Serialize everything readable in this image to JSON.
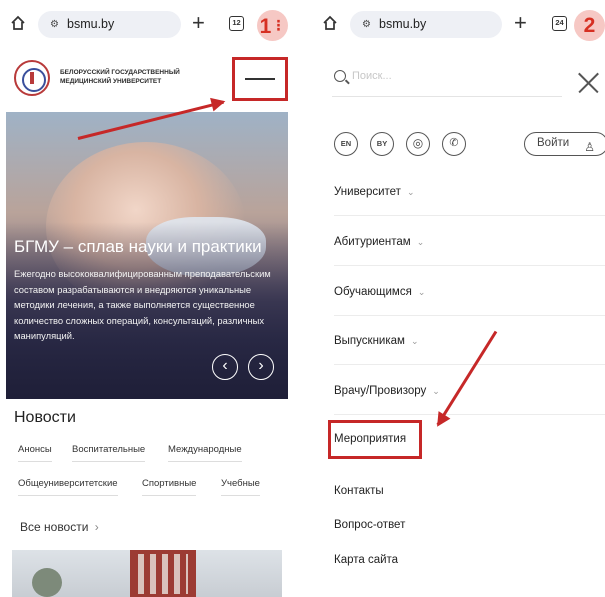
{
  "left": {
    "browser": {
      "url": "bsmu.by",
      "tab_count": "12",
      "step": "1"
    },
    "site_name_line1": "БЕЛОРУССКИЙ ГОСУДАРСТВЕННЫЙ",
    "site_name_line2": "МЕДИЦИНСКИЙ УНИВЕРСИТЕТ",
    "hero": {
      "title": "БГМУ – сплав науки и практики",
      "text": "Ежегодно высококвалифицированным преподавательским составом разрабатываются и внедряются уникальные методики лечения, а также выполняется существенное количество сложных операций, консультаций, различных манипуляций.",
      "prev_icon": "‹",
      "next_icon": "›"
    },
    "news": {
      "title": "Новости",
      "tags_row1": [
        "Анонсы",
        "Воспитательные",
        "Международные"
      ],
      "tags_row2": [
        "Общеуниверситетские",
        "Спортивные",
        "Учебные"
      ],
      "all_news": "Все новости",
      "all_news_chevron": "›"
    }
  },
  "right": {
    "browser": {
      "url": "bsmu.by",
      "tab_count": "24",
      "step": "2"
    },
    "search_placeholder": "Поиск...",
    "lang_buttons": [
      "EN",
      "BY"
    ],
    "login_label": "Войти",
    "menu_items": [
      {
        "label": "Университет",
        "chevron": "⌄"
      },
      {
        "label": "Абитуриентам",
        "chevron": "⌄"
      },
      {
        "label": "Обучающимся",
        "chevron": "⌄"
      },
      {
        "label": "Выпускникам",
        "chevron": "⌄"
      },
      {
        "label": "Врачу/Провизору",
        "chevron": "⌄"
      },
      {
        "label": "Мероприятия",
        "chevron": ""
      },
      {
        "label": "Контакты",
        "chevron": ""
      },
      {
        "label": "Вопрос-ответ",
        "chevron": ""
      },
      {
        "label": "Карта сайта",
        "chevron": ""
      }
    ]
  },
  "colors": {
    "annotation_red": "#c62828",
    "badge_bg": "#f6c8c4",
    "url_bar_bg": "#eef0f5"
  },
  "icons": [
    "home-icon",
    "tune-icon",
    "new-tab-plus-icon",
    "tabs-counter-icon",
    "hamburger-menu-icon",
    "search-icon",
    "close-icon",
    "eye-icon",
    "phone-icon",
    "user-icon",
    "chevron-down-icon"
  ]
}
